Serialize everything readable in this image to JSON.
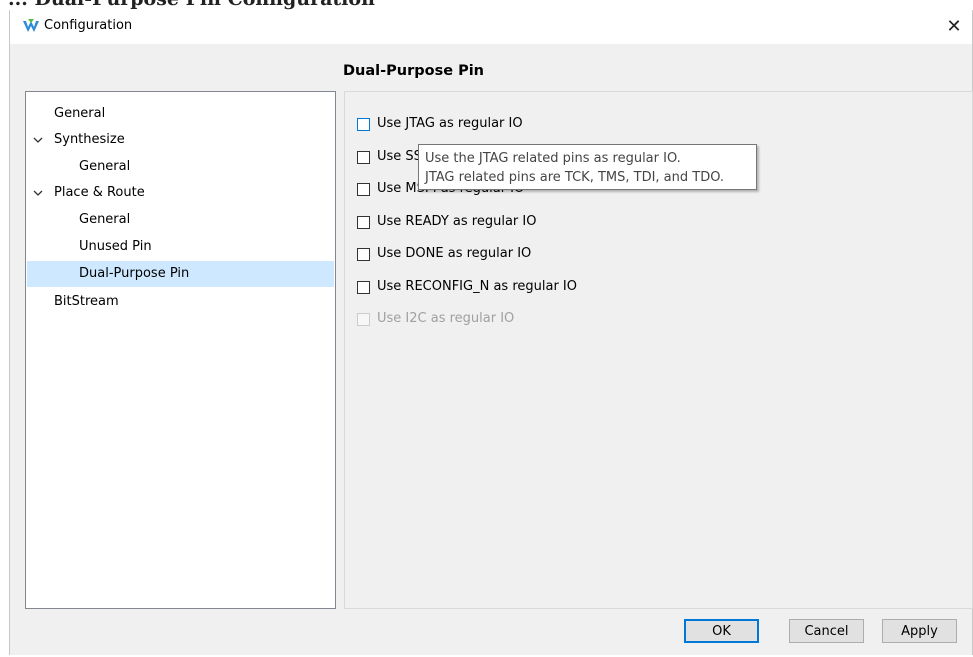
{
  "background_heading": "... Dual-Purpose Pin Configuration",
  "window": {
    "title": "Configuration",
    "close_label": "✕"
  },
  "section_heading": "Dual-Purpose Pin",
  "tree": {
    "items": [
      {
        "label": "General",
        "level": 0,
        "expandable": false
      },
      {
        "label": "Synthesize",
        "level": 0,
        "expandable": true,
        "expanded": true
      },
      {
        "label": "General",
        "level": 1,
        "expandable": false
      },
      {
        "label": "Place & Route",
        "level": 0,
        "expandable": true,
        "expanded": true
      },
      {
        "label": "General",
        "level": 1,
        "expandable": false
      },
      {
        "label": "Unused Pin",
        "level": 1,
        "expandable": false
      },
      {
        "label": "Dual-Purpose Pin",
        "level": 1,
        "expandable": false,
        "selected": true
      },
      {
        "label": "BitStream",
        "level": 0,
        "expandable": false
      }
    ]
  },
  "options": [
    {
      "label": "Use JTAG as regular IO",
      "checked": false,
      "enabled": true,
      "focused": true
    },
    {
      "label": "Use SSPI as regular IO",
      "checked": false,
      "enabled": true
    },
    {
      "label": "Use MSPI as regular IO",
      "checked": false,
      "enabled": true
    },
    {
      "label": "Use READY as regular IO",
      "checked": false,
      "enabled": true
    },
    {
      "label": "Use DONE as regular IO",
      "checked": false,
      "enabled": true
    },
    {
      "label": "Use RECONFIG_N as regular IO",
      "checked": false,
      "enabled": true
    },
    {
      "label": "Use I2C as regular IO",
      "checked": false,
      "enabled": false
    }
  ],
  "tooltip": {
    "line1": "Use the JTAG related pins as regular IO.",
    "line2": "JTAG related pins are TCK, TMS, TDI, and TDO."
  },
  "buttons": {
    "ok": "OK",
    "cancel": "Cancel",
    "apply": "Apply"
  },
  "colors": {
    "selection": "#cde8ff",
    "accent": "#0078d7",
    "dialog_bg": "#f0f0f0"
  }
}
